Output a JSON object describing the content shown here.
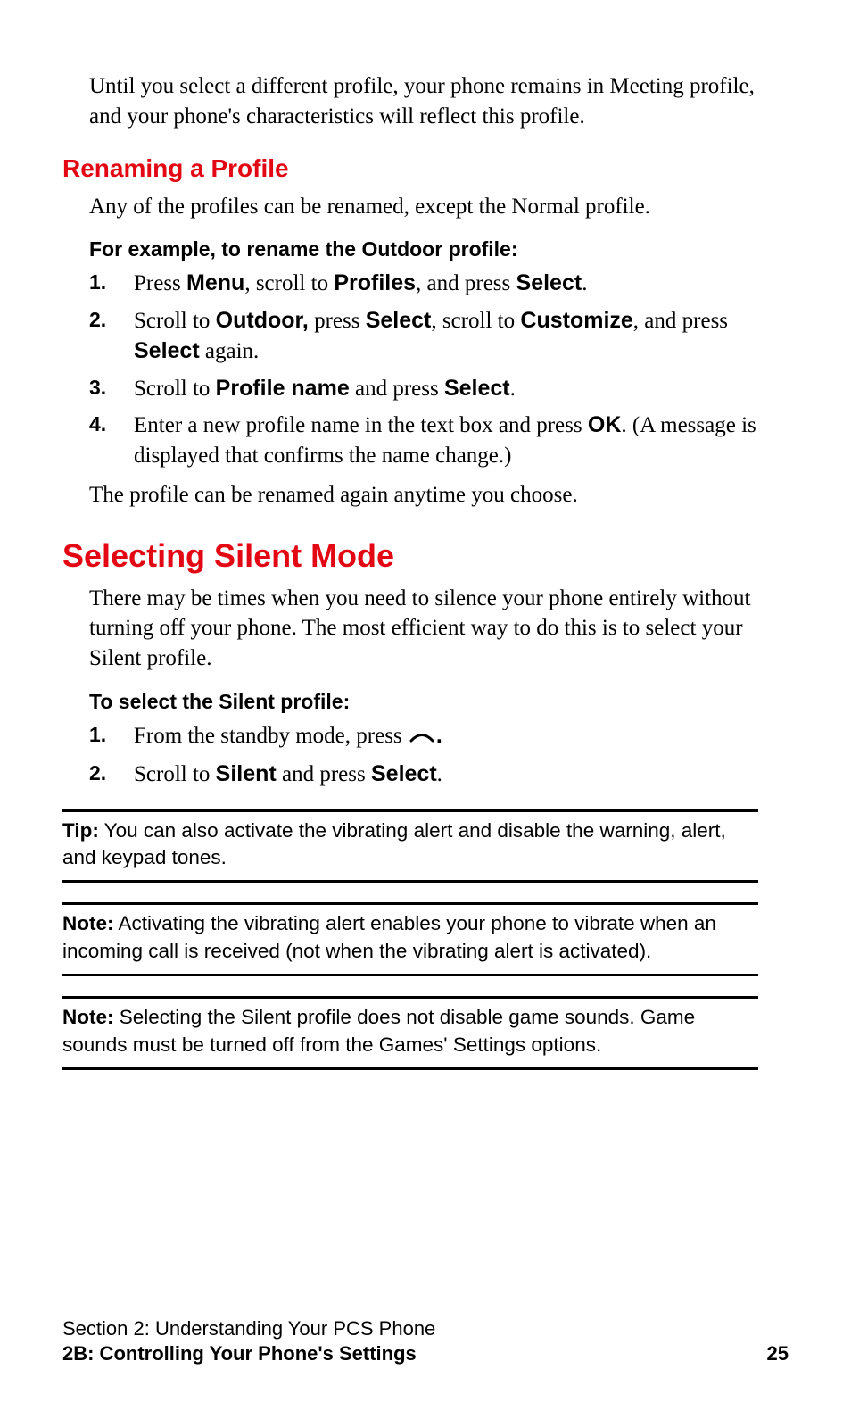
{
  "intro_paragraph": "Until you select a different profile, your phone remains in Meeting profile, and your phone's characteristics will reflect this profile.",
  "section_rename": {
    "heading": "Renaming a Profile",
    "desc": "Any of the profiles can be renamed, except the Normal profile.",
    "example_label": "For example, to rename the Outdoor profile:",
    "steps": [
      {
        "pre": "Press ",
        "b1": "Menu",
        "mid1": ", scroll to ",
        "b2": "Profiles",
        "mid2": ", and press ",
        "b3": "Select",
        "post": "."
      },
      {
        "pre": "Scroll to ",
        "b1": "Outdoor,",
        "mid1": " press ",
        "b2": "Select",
        "mid2": ", scroll to ",
        "b3": "Customize",
        "mid3": ", and press ",
        "b4": "Select",
        "post": " again."
      },
      {
        "pre": "Scroll to ",
        "b1": "Profile name",
        "mid1": " and press ",
        "b2": "Select",
        "post": "."
      },
      {
        "pre": "Enter a new profile name in the text box and press ",
        "b1": "OK",
        "post": ". (A message is displayed that confirms the name change.)"
      }
    ],
    "closing": "The profile can be renamed again anytime you choose."
  },
  "section_silent": {
    "heading": "Selecting Silent Mode",
    "desc": "There may be times when you need to silence your phone entirely without turning off your phone. The most efficient way to do this is to select your Silent profile.",
    "select_label": "To select the Silent profile:",
    "steps": [
      {
        "pre": "From the standby mode, press ",
        "icon": "arc-key-icon",
        "post": "."
      },
      {
        "pre": "Scroll to ",
        "b1": "Silent",
        "mid1": " and press ",
        "b2": "Select",
        "post": "."
      }
    ]
  },
  "tip": {
    "label": "Tip:",
    "text": " You can also activate the vibrating alert and disable the warning, alert, and keypad tones."
  },
  "note1": {
    "label": "Note:",
    "text": " Activating the vibrating alert enables your phone to vibrate when an incoming call is received (not when the vibrating alert is activated)."
  },
  "note2": {
    "label": "Note:",
    "text": " Selecting the Silent profile does not disable game sounds. Game sounds must be turned off from the Games' Settings options."
  },
  "footer": {
    "line1": "Section 2: Understanding Your PCS Phone",
    "line2": "2B: Controlling Your Phone's Settings",
    "page": "25"
  }
}
